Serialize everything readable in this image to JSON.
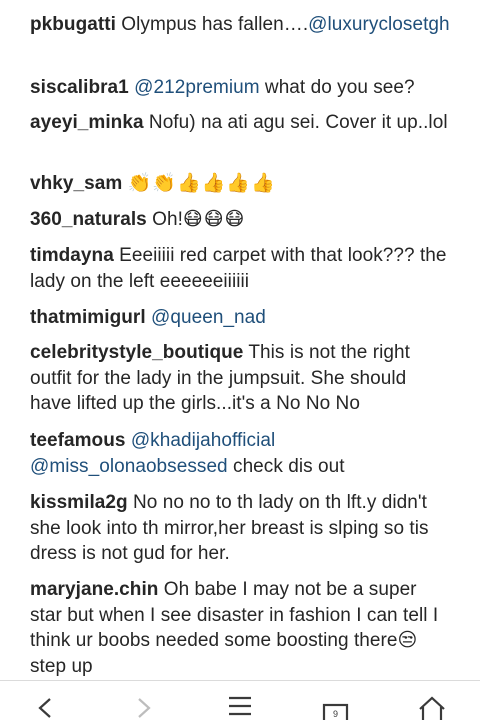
{
  "comments": [
    {
      "user": "pkbugatti",
      "parts": [
        {
          "t": "text",
          "v": "Olympus has fallen…."
        },
        {
          "t": "mention",
          "v": "@luxuryclosetgh"
        }
      ]
    },
    {
      "user": "siscalibra1",
      "parts": [
        {
          "t": "mention",
          "v": "@212premium"
        },
        {
          "t": "text",
          "v": " what do you see?"
        }
      ]
    },
    {
      "user": "ayeyi_minka",
      "parts": [
        {
          "t": "text",
          "v": "Nofu) na ati agu sei. Cover it up..lol"
        }
      ]
    },
    {
      "user": "vhky_sam",
      "parts": [
        {
          "t": "emoji",
          "v": "👏👏👍👍👍👍"
        }
      ]
    },
    {
      "user": "360_naturals",
      "parts": [
        {
          "t": "text",
          "v": "Oh!"
        },
        {
          "t": "emoji",
          "v": "😷😷😷"
        }
      ]
    },
    {
      "user": "timdayna",
      "parts": [
        {
          "t": "text",
          "v": "Eeeiiiii red carpet with that look??? the lady on the left eeeeeeiiiiii"
        }
      ]
    },
    {
      "user": "thatmimigurl",
      "parts": [
        {
          "t": "mention",
          "v": "@queen_nad"
        }
      ]
    },
    {
      "user": "celebritystyle_boutique",
      "parts": [
        {
          "t": "text",
          "v": "This is not the right outfit for the lady in the jumpsuit. She should have lifted up the girls...it's a No No No"
        }
      ]
    },
    {
      "user": "teefamous",
      "parts": [
        {
          "t": "mention",
          "v": "@khadijahofficial @miss_olonaobsessed"
        },
        {
          "t": "text",
          "v": " check dis out"
        }
      ]
    },
    {
      "user": "kissmila2g",
      "parts": [
        {
          "t": "text",
          "v": "No no no to th lady on th lft.y didn't she look into th mirror,her breast is slping so tis dress is not gud for her."
        }
      ]
    },
    {
      "user": "maryjane.chin",
      "parts": [
        {
          "t": "text",
          "v": "Oh babe I may not be a super star but when I see disaster in fashion I can tell I think ur boobs needed some boosting there"
        },
        {
          "t": "emoji",
          "v": "😒"
        },
        {
          "t": "text",
          "v": "step up"
        }
      ]
    }
  ],
  "nav": [
    {
      "name": "back-icon",
      "label": "back"
    },
    {
      "name": "forward-icon",
      "label": "forward"
    },
    {
      "name": "menu-icon",
      "label": "menu"
    },
    {
      "name": "tabs-icon",
      "label": "tabs",
      "count": "9"
    },
    {
      "name": "home-icon",
      "label": "home"
    }
  ],
  "colors": {
    "text": "#262626",
    "mention": "#1f4f7a",
    "divider": "#dbdbdb"
  }
}
